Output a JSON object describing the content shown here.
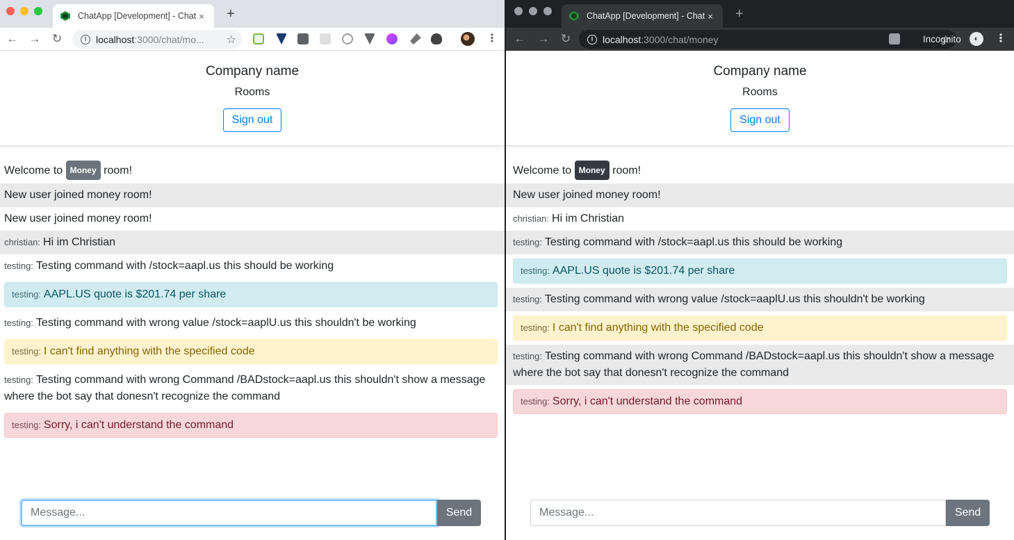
{
  "left": {
    "tab_title": "ChatApp [Development] - Chat",
    "tab_close": "×",
    "new_tab": "+",
    "url_host": "localhost",
    "url_path": ":3000/chat/mo...",
    "nav": {
      "back": "←",
      "forward": "→",
      "reload": "↻",
      "star": "☆",
      "menu": "⋮"
    },
    "messages": [
      {
        "type": "welcome",
        "prefix": "Welcome to",
        "badge": "Money",
        "suffix": "room!"
      },
      {
        "type": "plain",
        "shade": "gray",
        "text": "New user joined money room!"
      },
      {
        "type": "plain",
        "shade": "white",
        "text": "New user joined money room!"
      },
      {
        "type": "user",
        "shade": "gray",
        "user": "christian:",
        "text": "Hi im Christian"
      },
      {
        "type": "user",
        "shade": "white",
        "user": "testing:",
        "text": "Testing command with /stock=aapl.us this should be working"
      },
      {
        "type": "alert",
        "variant": "info",
        "user": "testing:",
        "text": "AAPL.US quote is $201.74 per share"
      },
      {
        "type": "user",
        "shade": "white",
        "user": "testing:",
        "text": "Testing command with wrong value /stock=aaplU.us this shouldn't be working"
      },
      {
        "type": "alert",
        "variant": "warning",
        "user": "testing:",
        "text": "I can't find anything with the specified code"
      },
      {
        "type": "user",
        "shade": "white",
        "user": "testing:",
        "text": "Testing command with wrong Command /BADstock=aapl.us this shouldn't show a message where the bot say that donesn't recognize the command"
      },
      {
        "type": "alert",
        "variant": "danger",
        "user": "testing:",
        "text": "Sorry, i can't understand the command"
      }
    ]
  },
  "right": {
    "tab_title": "ChatApp [Development] - Chat",
    "tab_close": "×",
    "new_tab": "+",
    "url_host": "localhost",
    "url_path": ":3000/chat/money",
    "incognito_label": "Incognito",
    "nav": {
      "back": "←",
      "forward": "→",
      "reload": "↻",
      "star": "☆",
      "menu": "⋮"
    },
    "messages": [
      {
        "type": "welcome",
        "prefix": "Welcome to",
        "badge": "Money",
        "suffix": "room!"
      },
      {
        "type": "plain",
        "shade": "gray",
        "text": "New user joined money room!"
      },
      {
        "type": "user",
        "shade": "white",
        "user": "christian:",
        "text": "Hi im Christian"
      },
      {
        "type": "user",
        "shade": "gray",
        "user": "testing:",
        "text": "Testing command with /stock=aapl.us this should be working"
      },
      {
        "type": "alert",
        "variant": "info",
        "user": "testing:",
        "text": "AAPL.US quote is $201.74 per share"
      },
      {
        "type": "user",
        "shade": "gray",
        "user": "testing:",
        "text": "Testing command with wrong value /stock=aaplU.us this shouldn't be working"
      },
      {
        "type": "alert",
        "variant": "warning",
        "user": "testing:",
        "text": "I can't find anything with the specified code"
      },
      {
        "type": "user",
        "shade": "gray",
        "user": "testing:",
        "text": "Testing command with wrong Command /BADstock=aapl.us this shouldn't show a message where the bot say that donesn't recognize the command"
      },
      {
        "type": "alert",
        "variant": "danger",
        "user": "testing:",
        "text": "Sorry, i can't understand the command"
      }
    ]
  },
  "app": {
    "company_name": "Company name",
    "rooms_link": "Rooms",
    "sign_out": "Sign out",
    "message_placeholder": "Message...",
    "send_label": "Send"
  },
  "colors": {
    "traffic_red": "#ff5f57",
    "traffic_yellow": "#febc2e",
    "traffic_green": "#28c840",
    "primary": "#007bff",
    "secondary": "#6c757d"
  }
}
